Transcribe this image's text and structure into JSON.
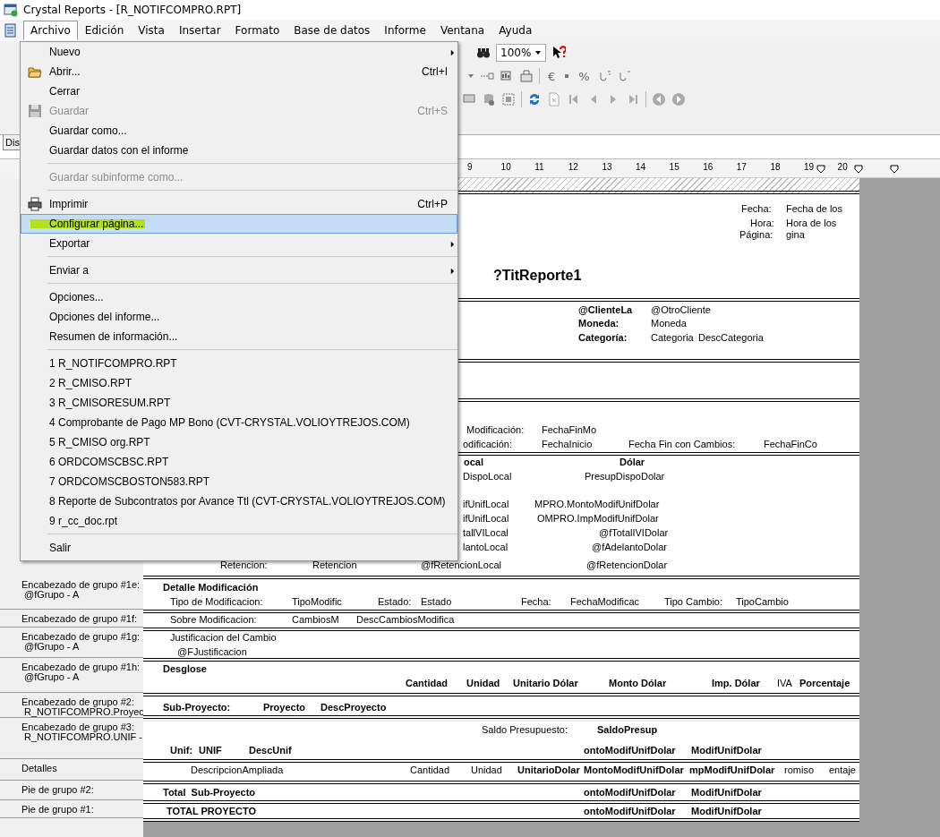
{
  "window": {
    "title": "Crystal Reports - [R_NOTIFCOMPRO.RPT]"
  },
  "menubar": [
    {
      "label": "Archivo",
      "selected": true
    },
    {
      "label": "Edición",
      "selected": false
    },
    {
      "label": "Vista",
      "selected": false
    },
    {
      "label": "Insertar",
      "selected": false
    },
    {
      "label": "Formato",
      "selected": false
    },
    {
      "label": "Base de datos",
      "selected": false
    },
    {
      "label": "Informe",
      "selected": false
    },
    {
      "label": "Ventana",
      "selected": false
    },
    {
      "label": "Ayuda",
      "selected": false
    }
  ],
  "toolbar": {
    "zoom": "100%",
    "symbols": [
      "€",
      "%"
    ]
  },
  "design_tab": {
    "label": "Dis"
  },
  "ruler": [
    "9",
    "10",
    "11",
    "12",
    "13",
    "14",
    "15",
    "16",
    "17",
    "18",
    "19",
    "20"
  ],
  "menu": {
    "items": [
      {
        "kind": "item",
        "label": "Nuevo",
        "submenu": true,
        "disabled": false,
        "selected": false,
        "highlighted": false
      },
      {
        "kind": "item",
        "label": "Abrir...",
        "shortcut": "Ctrl+I",
        "submenu": false,
        "disabled": false,
        "selected": false,
        "highlighted": false
      },
      {
        "kind": "item",
        "label": "Cerrar",
        "submenu": false,
        "disabled": false,
        "selected": false,
        "highlighted": false
      },
      {
        "kind": "item",
        "label": "Guardar",
        "shortcut": "Ctrl+S",
        "submenu": false,
        "disabled": true,
        "selected": false,
        "highlighted": false
      },
      {
        "kind": "item",
        "label": "Guardar como...",
        "submenu": false,
        "disabled": false,
        "selected": false,
        "highlighted": false
      },
      {
        "kind": "item",
        "label": "Guardar datos con el informe",
        "submenu": false,
        "disabled": false,
        "selected": false,
        "highlighted": false
      },
      {
        "kind": "separator"
      },
      {
        "kind": "item",
        "label": "Guardar subinforme como...",
        "submenu": false,
        "disabled": true,
        "selected": false,
        "highlighted": false
      },
      {
        "kind": "separator"
      },
      {
        "kind": "item",
        "label": "Imprimir",
        "shortcut": "Ctrl+P",
        "submenu": false,
        "disabled": false,
        "selected": false,
        "highlighted": false
      },
      {
        "kind": "item",
        "label": "Configurar página...",
        "submenu": false,
        "disabled": false,
        "selected": true,
        "highlighted": true
      },
      {
        "kind": "item",
        "label": "Exportar",
        "submenu": true,
        "disabled": false,
        "selected": false,
        "highlighted": false
      },
      {
        "kind": "separator"
      },
      {
        "kind": "item",
        "label": "Enviar a",
        "submenu": true,
        "disabled": false,
        "selected": false,
        "highlighted": false
      },
      {
        "kind": "separator"
      },
      {
        "kind": "item",
        "label": "Opciones...",
        "submenu": false,
        "disabled": false,
        "selected": false,
        "highlighted": false
      },
      {
        "kind": "item",
        "label": "Opciones del informe...",
        "submenu": false,
        "disabled": false,
        "selected": false,
        "highlighted": false
      },
      {
        "kind": "item",
        "label": "Resumen de información...",
        "submenu": false,
        "disabled": false,
        "selected": false,
        "highlighted": false
      },
      {
        "kind": "separator"
      },
      {
        "kind": "item",
        "label": "1 R_NOTIFCOMPRO.RPT",
        "submenu": false,
        "disabled": false,
        "selected": false,
        "highlighted": false
      },
      {
        "kind": "item",
        "label": "2 R_CMISO.RPT",
        "submenu": false,
        "disabled": false,
        "selected": false,
        "highlighted": false
      },
      {
        "kind": "item",
        "label": "3 R_CMISORESUM.RPT",
        "submenu": false,
        "disabled": false,
        "selected": false,
        "highlighted": false
      },
      {
        "kind": "item",
        "label": "4 Comprobante de Pago MP Bono (CVT-CRYSTAL.VOLIOYTREJOS.COM)",
        "submenu": false,
        "disabled": false,
        "selected": false,
        "highlighted": false
      },
      {
        "kind": "item",
        "label": "5 R_CMISO org.RPT",
        "submenu": false,
        "disabled": false,
        "selected": false,
        "highlighted": false
      },
      {
        "kind": "item",
        "label": "6 ORDCOMSCBSC.RPT",
        "submenu": false,
        "disabled": false,
        "selected": false,
        "highlighted": false
      },
      {
        "kind": "item",
        "label": "7 ORDCOMSCBOSTON583.RPT",
        "submenu": false,
        "disabled": false,
        "selected": false,
        "highlighted": false
      },
      {
        "kind": "item",
        "label": "8 Reporte de Subcontratos por Avance Ttl (CVT-CRYSTAL.VOLIOYTREJOS.COM)",
        "submenu": false,
        "disabled": false,
        "selected": false,
        "highlighted": false
      },
      {
        "kind": "item",
        "label": "9 r_cc_doc.rpt",
        "submenu": false,
        "disabled": false,
        "selected": false,
        "highlighted": false
      },
      {
        "kind": "separator"
      },
      {
        "kind": "item",
        "label": "Salir",
        "submenu": false,
        "disabled": false,
        "selected": false,
        "highlighted": false
      }
    ]
  },
  "report": {
    "bands": [
      {
        "kind": "hatched"
      },
      {
        "kind": "band",
        "fields": [
          {
            "text": "Fecha:",
            "kind": "plain"
          },
          {
            "text": "Fecha de los",
            "kind": "plain"
          },
          {
            "text": "Hora:",
            "kind": "plain"
          },
          {
            "text": "Hora de los",
            "kind": "plain"
          },
          {
            "text": "Página:",
            "kind": "plain"
          },
          {
            "text": "gina",
            "kind": "plain"
          },
          {
            "text": "?TitReporte1",
            "kind": "title"
          }
        ]
      },
      {
        "kind": "band",
        "fields": [
          {
            "text": "@ClienteLa",
            "kind": "bold"
          },
          {
            "text": "@OtroCliente",
            "kind": "plain"
          },
          {
            "text": "Moneda:",
            "kind": "bold"
          },
          {
            "text": "Moneda",
            "kind": "plain"
          },
          {
            "text": "Categoría:",
            "kind": "bold"
          },
          {
            "text": "Categoria",
            "kind": "plain"
          },
          {
            "text": "DescCategoria",
            "kind": "plain"
          }
        ]
      },
      {
        "kind": "band"
      },
      {
        "kind": "band",
        "fields": [
          {
            "text": "Modificación:",
            "kind": "plain"
          },
          {
            "text": "FechaFinMo",
            "kind": "plain"
          },
          {
            "text": "odificación:",
            "kind": "plain"
          },
          {
            "text": "FechaInicio",
            "kind": "plain"
          },
          {
            "text": "Fecha Fin con Cambios:",
            "kind": "plain"
          },
          {
            "text": "FechaFinCo",
            "kind": "plain"
          }
        ]
      },
      {
        "kind": "band",
        "fields": [
          {
            "text": "ocal",
            "kind": "bold"
          },
          {
            "text": "Dólar",
            "kind": "bold"
          },
          {
            "text": "DispoLocal",
            "kind": "plain"
          },
          {
            "text": "PresupDispoDolar",
            "kind": "plain"
          },
          {
            "text": "ifUnifLocal",
            "kind": "plain"
          },
          {
            "text": "MPRO.MontoModifUnifDolar",
            "kind": "plain"
          },
          {
            "text": "ifUnifLocal",
            "kind": "plain"
          },
          {
            "text": "OMPRO.ImpModifUnifDolar",
            "kind": "plain"
          },
          {
            "text": "tallVILocal",
            "kind": "plain"
          },
          {
            "text": "@fTotalIVIDolar",
            "kind": "plain"
          },
          {
            "text": "lantoLocal",
            "kind": "plain"
          },
          {
            "text": "@fAdelantoDolar",
            "kind": "plain"
          },
          {
            "text": "Retencion:",
            "kind": "plain"
          },
          {
            "text": "Retencion",
            "kind": "plain"
          },
          {
            "text": "@fRetencionLocal",
            "kind": "plain"
          },
          {
            "text": "@fRetencionDolar",
            "kind": "plain"
          }
        ]
      },
      {
        "kind": "band",
        "label": [
          "Encabezado de grupo #1e:",
          "@fGrupo - A"
        ],
        "fields": [
          {
            "text": "Detalle Modificación",
            "kind": "bold"
          },
          {
            "text": "Tipo de Modificacion:",
            "kind": "plain"
          },
          {
            "text": "TipoModific",
            "kind": "plain"
          },
          {
            "text": "Estado:",
            "kind": "plain"
          },
          {
            "text": "Estado",
            "kind": "plain"
          },
          {
            "text": "Fecha:",
            "kind": "plain"
          },
          {
            "text": "FechaModificac",
            "kind": "plain"
          },
          {
            "text": "Tipo Cambio:",
            "kind": "plain"
          },
          {
            "text": "TipoCambio",
            "kind": "plain"
          }
        ]
      },
      {
        "kind": "band",
        "label": [
          "Encabezado de grupo #1f:"
        ],
        "fields": [
          {
            "text": "Sobre Modificacion:",
            "kind": "plain"
          },
          {
            "text": "CambiosM",
            "kind": "plain"
          },
          {
            "text": "DescCambiosModifica",
            "kind": "plain"
          }
        ]
      },
      {
        "kind": "band",
        "label": [
          "Encabezado de grupo #1g:",
          "@fGrupo - A"
        ],
        "fields": [
          {
            "text": "Justificacion del Cambio",
            "kind": "plain"
          },
          {
            "text": "@FJustificacion",
            "kind": "plain"
          }
        ]
      },
      {
        "kind": "band",
        "label": [
          "Encabezado de grupo #1h:",
          "@fGrupo - A"
        ],
        "fields": [
          {
            "text": "Desglose",
            "kind": "bold"
          },
          {
            "text": "Cantidad",
            "kind": "bold"
          },
          {
            "text": "Unidad",
            "kind": "bold"
          },
          {
            "text": "Unitario Dólar",
            "kind": "bold"
          },
          {
            "text": "Monto Dólar",
            "kind": "bold"
          },
          {
            "text": "Imp. Dólar",
            "kind": "bold"
          },
          {
            "text": "IVA",
            "kind": "plain"
          },
          {
            "text": "Porcentaje",
            "kind": "bold"
          }
        ]
      },
      {
        "kind": "band",
        "label": [
          "Encabezado de grupo #2:",
          "R_NOTIFCOMPRO.Proyec"
        ],
        "fields": [
          {
            "text": "Sub-Proyecto:",
            "kind": "bold"
          },
          {
            "text": "Proyecto",
            "kind": "bold"
          },
          {
            "text": "DescProyecto",
            "kind": "bold"
          }
        ]
      },
      {
        "kind": "band",
        "label": [
          "Encabezado de grupo #3:",
          "R_NOTIFCOMPRO.UNIF -"
        ],
        "fields": [
          {
            "text": "Saldo Presupuesto:",
            "kind": "plain"
          },
          {
            "text": "SaldoPresup",
            "kind": "bold"
          },
          {
            "text": "Unif:",
            "kind": "bold"
          },
          {
            "text": "UNIF",
            "kind": "bold"
          },
          {
            "text": "DescUnif",
            "kind": "bold"
          },
          {
            "text": "ontoModifUnifDolar",
            "kind": "bold"
          },
          {
            "text": "ModifUnifDolar",
            "kind": "bold"
          }
        ]
      },
      {
        "kind": "band",
        "label": [
          "Detalles"
        ],
        "fields": [
          {
            "text": "DescripcionAmpliada",
            "kind": "plain"
          },
          {
            "text": "Cantidad",
            "kind": "plain"
          },
          {
            "text": "Unidad",
            "kind": "plain"
          },
          {
            "text": "UnitarioDolar",
            "kind": "bold"
          },
          {
            "text": "MontoModifUnifDolar",
            "kind": "bold"
          },
          {
            "text": "mpModifUnifDolar",
            "kind": "bold"
          },
          {
            "text": "romiso",
            "kind": "plain"
          },
          {
            "text": "entaje",
            "kind": "plain"
          }
        ]
      },
      {
        "kind": "band",
        "label": [
          "Pie de grupo #2:"
        ],
        "fields": [
          {
            "text": "Total  Sub-Proyecto",
            "kind": "bold"
          },
          {
            "text": "ontoModifUnifDolar",
            "kind": "bold"
          },
          {
            "text": "ModifUnifDolar",
            "kind": "bold"
          }
        ]
      },
      {
        "kind": "band",
        "label": [
          "Pie de grupo #1:"
        ],
        "fields": [
          {
            "text": "TOTAL PROYECTO",
            "kind": "bold"
          },
          {
            "text": "ontoModifUnifDolar",
            "kind": "bold"
          },
          {
            "text": "ModifUnifDolar",
            "kind": "bold"
          }
        ]
      }
    ]
  }
}
